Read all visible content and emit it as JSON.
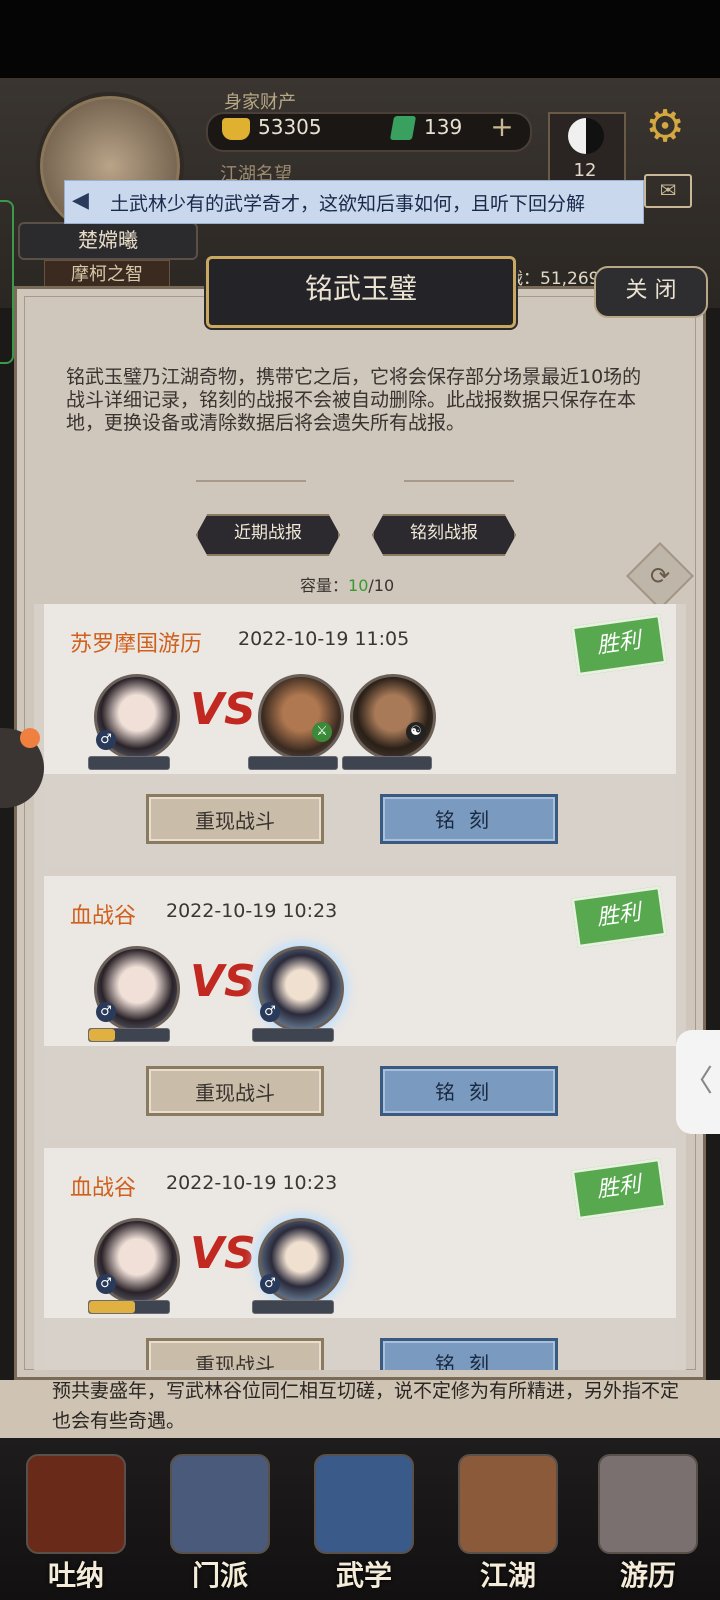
{
  "header": {
    "wealth_label": "身家财产",
    "coins": "53305",
    "jade": "139",
    "plus": "+",
    "taiji_count": "12",
    "reputation_label": "江湖名望",
    "player_name": "楚嫦曦",
    "player_title": "摩柯之智",
    "power_text": "战：51,269"
  },
  "broadcast": {
    "text": "土武林少有的武学奇才，这欲知后事如何，且听下回分解"
  },
  "panel": {
    "title": "铭武玉璧",
    "close_label": "关 闭",
    "description": "铭武玉璧乃江湖奇物，携带它之后，它将会保存部分场景最近10场的战斗详细记录，铭刻的战报不会被自动删除。此战报数据只保存在本地，更换设备或清除数据后将会遗失所有战报。",
    "tabs": [
      {
        "label": "近期战报"
      },
      {
        "label": "铭刻战报"
      }
    ],
    "capacity_label": "容量：",
    "capacity_current": "10",
    "capacity_max": "/10"
  },
  "battles": [
    {
      "location": "苏罗摩国游历",
      "time": "2022-10-19 11:05",
      "result": "胜利",
      "vs": "VS",
      "player_hp": 0.0,
      "enemies": [
        {
          "hp": 0.0
        },
        {
          "hp": 0.0
        }
      ],
      "replay_label": "重现战斗",
      "engrave_label": "铭刻"
    },
    {
      "location": "血战谷",
      "time": "2022-10-19 10:23",
      "result": "胜利",
      "vs": "VS",
      "player_hp": 0.32,
      "enemies": [
        {
          "hp": 0.0
        }
      ],
      "replay_label": "重现战斗",
      "engrave_label": "铭刻"
    },
    {
      "location": "血战谷",
      "time": "2022-10-19 10:23",
      "result": "胜利",
      "vs": "VS",
      "player_hp": 0.58,
      "enemies": [
        {
          "hp": 0.0
        }
      ],
      "replay_label": "重现战斗",
      "engrave_label": "铭刻"
    }
  ],
  "below_text": "预共妻盛年，写武林谷位同仁相互切磋，说不定修为有所精进，另外指不定也会有些奇遇。",
  "nav": [
    {
      "label": "吐纳",
      "icon": "gourd-icon"
    },
    {
      "label": "门派",
      "icon": "sect-icon"
    },
    {
      "label": "武学",
      "icon": "book-icon"
    },
    {
      "label": "江湖",
      "icon": "hat-icon"
    },
    {
      "label": "游历",
      "icon": "horse-icon"
    }
  ],
  "colors": {
    "accent_orange": "#d0601e",
    "victory_green": "#58a850",
    "engrave_blue": "#7a9ac0"
  }
}
